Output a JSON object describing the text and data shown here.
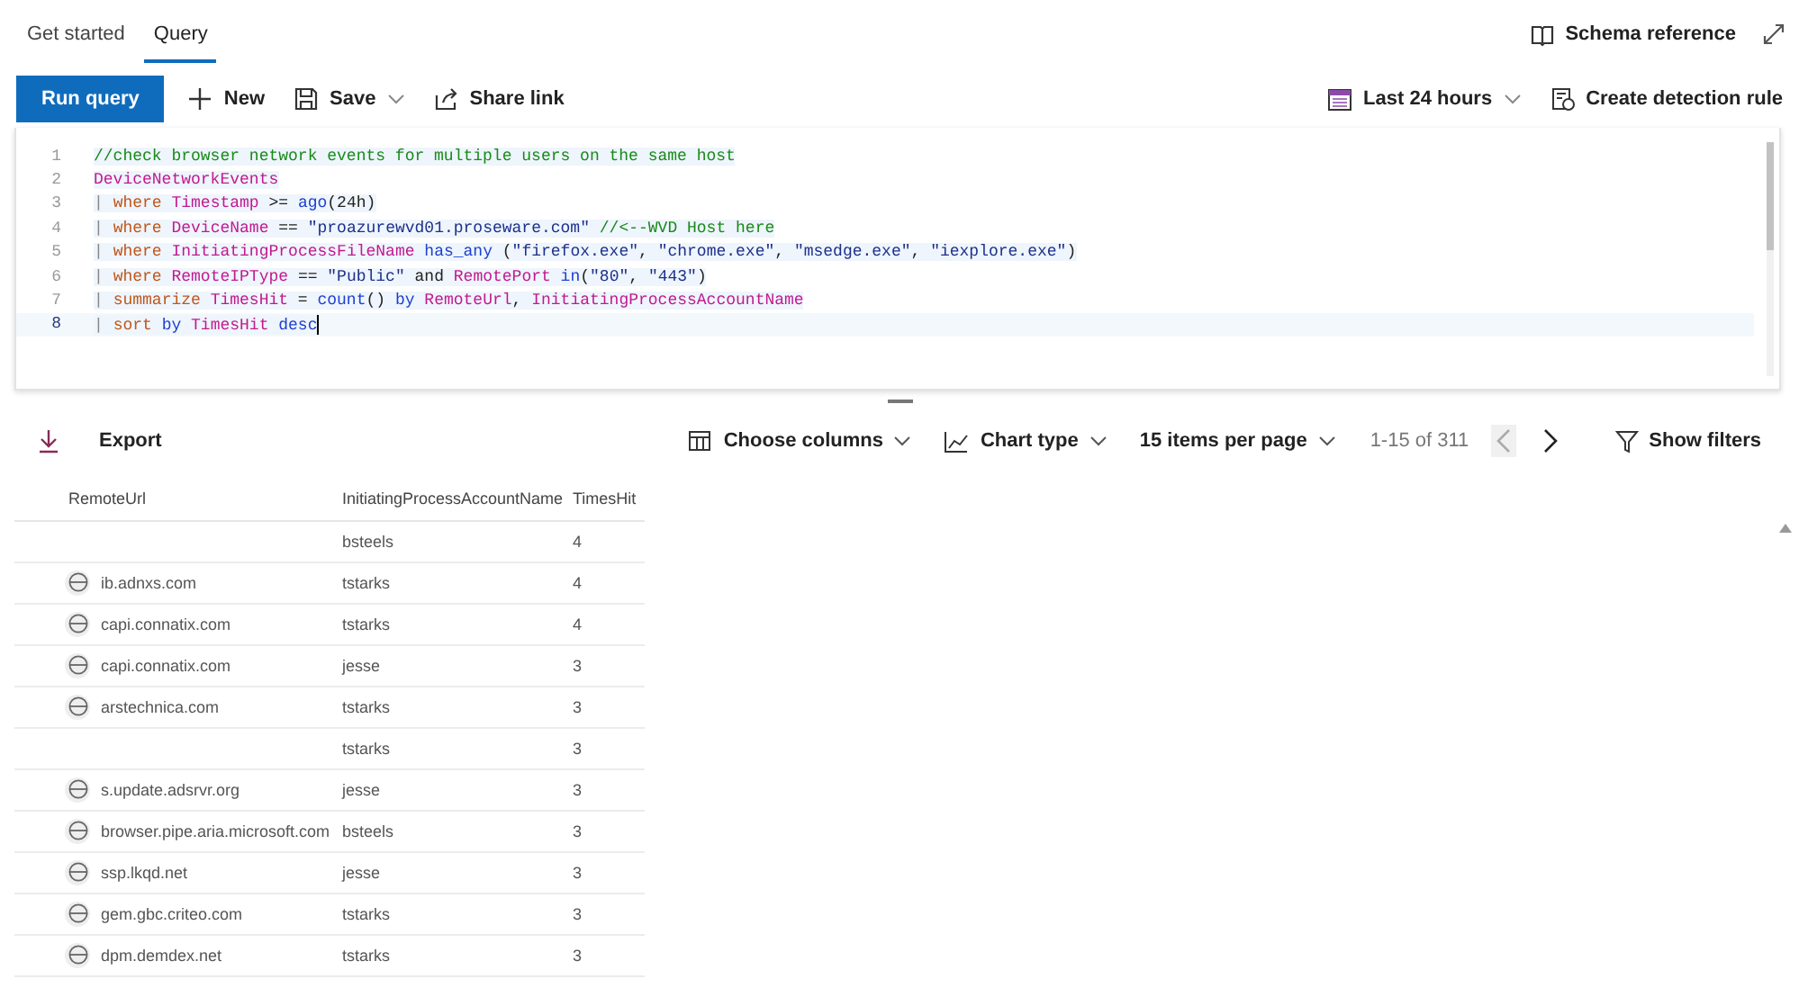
{
  "tabs": [
    {
      "label": "Get started",
      "selected": false
    },
    {
      "label": "Query",
      "selected": true
    }
  ],
  "top_actions": [
    {
      "kind": "book",
      "label": "Schema reference"
    },
    {
      "kind": "expand"
    }
  ],
  "toolbar": {
    "run": "Run query",
    "left": [
      {
        "kind": "plus",
        "label": "New",
        "dropdown": false
      },
      {
        "kind": "save",
        "label": "Save",
        "dropdown": true
      },
      {
        "kind": "share",
        "label": "Share link",
        "dropdown": false
      }
    ],
    "right": [
      {
        "kind": "calendar",
        "label": "Last 24 hours",
        "dropdown": true
      },
      {
        "kind": "rule",
        "label": "Create detection rule",
        "dropdown": false
      }
    ]
  },
  "editor": {
    "lines": [
      {
        "number": "1",
        "current": false,
        "tokens": [
          {
            "kind": "comment",
            "text": "//check browser network events for multiple users on the same host"
          }
        ]
      },
      {
        "number": "2",
        "current": false,
        "tokens": [
          {
            "kind": "table",
            "text": "DeviceNetworkEvents"
          }
        ]
      },
      {
        "number": "3",
        "current": false,
        "tokens": [
          {
            "kind": "pipe",
            "text": "| "
          },
          {
            "kind": "keyword",
            "text": "where"
          },
          {
            "kind": "field",
            "text": " Timestamp"
          },
          {
            "kind": "plain",
            "text": " >= "
          },
          {
            "kind": "function",
            "text": "ago"
          },
          {
            "kind": "plain",
            "text": "(24h)"
          }
        ]
      },
      {
        "number": "4",
        "current": false,
        "tokens": [
          {
            "kind": "pipe",
            "text": "| "
          },
          {
            "kind": "keyword",
            "text": "where"
          },
          {
            "kind": "field",
            "text": " DeviceName"
          },
          {
            "kind": "plain",
            "text": " == "
          },
          {
            "kind": "string",
            "text": "\"proazurewvd01.proseware.com\""
          },
          {
            "kind": "comment",
            "text": " //<--WVD Host here"
          }
        ]
      },
      {
        "number": "5",
        "current": false,
        "tokens": [
          {
            "kind": "pipe",
            "text": "| "
          },
          {
            "kind": "keyword",
            "text": "where"
          },
          {
            "kind": "field",
            "text": " InitiatingProcessFileName"
          },
          {
            "kind": "function",
            "text": " has_any"
          },
          {
            "kind": "plain",
            "text": " ("
          },
          {
            "kind": "string",
            "text": "\"firefox.exe\""
          },
          {
            "kind": "plain",
            "text": ", "
          },
          {
            "kind": "string",
            "text": "\"chrome.exe\""
          },
          {
            "kind": "plain",
            "text": ", "
          },
          {
            "kind": "string",
            "text": "\"msedge.exe\""
          },
          {
            "kind": "plain",
            "text": ", "
          },
          {
            "kind": "string",
            "text": "\"iexplore.exe\""
          },
          {
            "kind": "plain",
            "text": ")"
          }
        ]
      },
      {
        "number": "6",
        "current": false,
        "tokens": [
          {
            "kind": "pipe",
            "text": "| "
          },
          {
            "kind": "keyword",
            "text": "where"
          },
          {
            "kind": "field",
            "text": " RemoteIPType"
          },
          {
            "kind": "plain",
            "text": " == "
          },
          {
            "kind": "string",
            "text": "\"Public\""
          },
          {
            "kind": "plain",
            "text": " and "
          },
          {
            "kind": "field",
            "text": "RemotePort"
          },
          {
            "kind": "function",
            "text": " in"
          },
          {
            "kind": "plain",
            "text": "("
          },
          {
            "kind": "string",
            "text": "\"80\""
          },
          {
            "kind": "plain",
            "text": ", "
          },
          {
            "kind": "string",
            "text": "\"443\""
          },
          {
            "kind": "plain",
            "text": ")"
          }
        ]
      },
      {
        "number": "7",
        "current": false,
        "tokens": [
          {
            "kind": "pipe",
            "text": "| "
          },
          {
            "kind": "keyword",
            "text": "summarize"
          },
          {
            "kind": "field",
            "text": " TimesHit"
          },
          {
            "kind": "plain",
            "text": " = "
          },
          {
            "kind": "function",
            "text": "count"
          },
          {
            "kind": "plain",
            "text": "() "
          },
          {
            "kind": "function",
            "text": "by"
          },
          {
            "kind": "field",
            "text": " RemoteUrl"
          },
          {
            "kind": "plain",
            "text": ", "
          },
          {
            "kind": "field",
            "text": "InitiatingProcessAccountName"
          }
        ]
      },
      {
        "number": "8",
        "current": true,
        "tokens": [
          {
            "kind": "pipe",
            "text": "| "
          },
          {
            "kind": "keyword",
            "text": "sort"
          },
          {
            "kind": "function",
            "text": " by"
          },
          {
            "kind": "field",
            "text": " TimesHit"
          },
          {
            "kind": "function",
            "text": " desc"
          }
        ]
      }
    ]
  },
  "results_toolbar": {
    "export": "Export",
    "right": [
      {
        "kind": "columns",
        "label": "Choose columns",
        "dropdown": true
      },
      {
        "kind": "chart",
        "label": "Chart type",
        "dropdown": true
      },
      {
        "kind": "none",
        "label": "15 items per page",
        "dropdown": true
      }
    ],
    "range": "1-15 of 311",
    "prev_disabled": true,
    "filters": "Show filters"
  },
  "table": {
    "columns": [
      "RemoteUrl",
      "InitiatingProcessAccountName",
      "TimesHit"
    ],
    "rows": [
      {
        "account": "bsteels",
        "hits": "4"
      },
      {
        "url": "ib.adnxs.com",
        "account": "tstarks",
        "hits": "4"
      },
      {
        "url": "capi.connatix.com",
        "account": "tstarks",
        "hits": "4"
      },
      {
        "url": "capi.connatix.com",
        "account": "jesse",
        "hits": "3"
      },
      {
        "url": "arstechnica.com",
        "account": "tstarks",
        "hits": "3"
      },
      {
        "account": "tstarks",
        "hits": "3"
      },
      {
        "url": "s.update.adsrvr.org",
        "account": "jesse",
        "hits": "3"
      },
      {
        "url": "browser.pipe.aria.microsoft.com",
        "account": "bsteels",
        "hits": "3"
      },
      {
        "url": "ssp.lkqd.net",
        "account": "jesse",
        "hits": "3"
      },
      {
        "url": "gem.gbc.criteo.com",
        "account": "tstarks",
        "hits": "3"
      },
      {
        "url": "dpm.demdex.net",
        "account": "tstarks",
        "hits": "3"
      }
    ]
  }
}
